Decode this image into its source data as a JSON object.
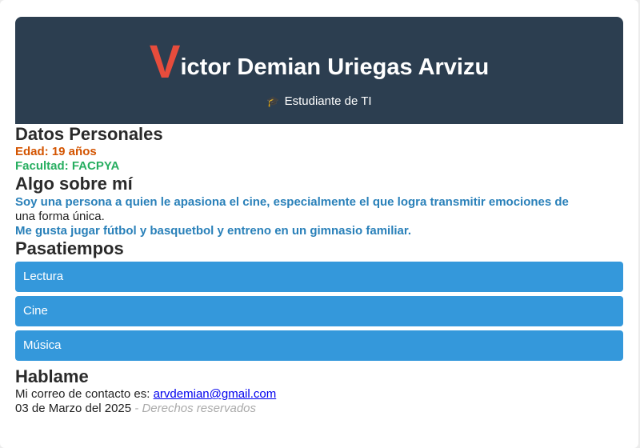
{
  "header": {
    "name_initial": "V",
    "name_rest": "ictor Demian Uriegas Arvizu",
    "subtitle_icon": "graduation-cap-icon",
    "subtitle": "Estudiante de TI"
  },
  "personal": {
    "heading": "Datos Personales",
    "age": "Edad: 19 años",
    "faculty": "Facultad: FACPYA"
  },
  "about": {
    "heading": "Algo sobre mí",
    "line1_bold": "Soy una persona a quien le apasiona el cine, especialmente el que logra transmitir emociones de",
    "line1_plain": "una forma única.",
    "line2_bold": "Me gusta jugar fútbol y basquetbol y entreno en un gimnasio familiar."
  },
  "hobbies": {
    "heading": "Pasatiempos",
    "items": [
      "Lectura",
      "Cine",
      "Música"
    ]
  },
  "contact": {
    "heading": "Hablame",
    "text": "Mi correo de contacto es:",
    "email": "arvdemian@gmail.com",
    "date": "03 de Marzo del 2025",
    "rights": "- Derechos reservados"
  },
  "colors": {
    "header_bg": "#2c3e50",
    "initial": "#e74c3c",
    "age": "#d35400",
    "faculty": "#27ae60",
    "about": "#2980b9",
    "hobby_bg": "#3498db"
  }
}
